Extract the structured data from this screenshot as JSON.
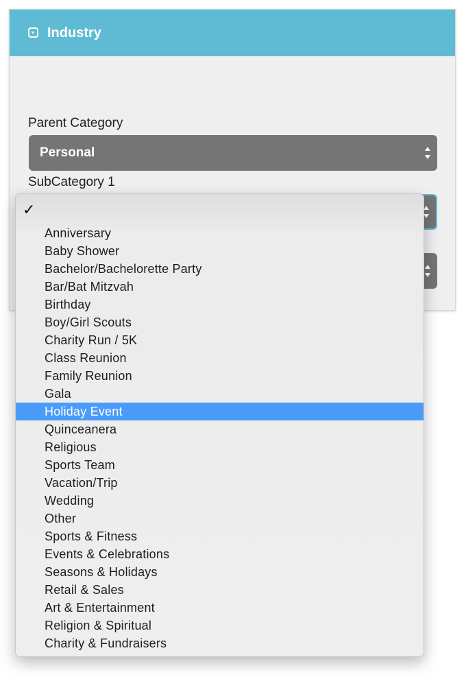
{
  "panel": {
    "title": "Industry",
    "header_icon": "chevron-down-square-icon",
    "header_color": "#5fbbd3"
  },
  "fields": {
    "parent_category": {
      "label": "Parent Category",
      "value": "Personal"
    },
    "subcategory_1": {
      "label": "SubCategory 1",
      "value": ""
    }
  },
  "dropdown": {
    "checkmark": "✓",
    "selected_option": "Holiday Event",
    "highlight_color": "#4b9bf9",
    "options": [
      "Anniversary",
      "Baby Shower",
      "Bachelor/Bachelorette Party",
      "Bar/Bat Mitzvah",
      "Birthday",
      "Boy/Girl Scouts",
      "Charity Run / 5K",
      "Class Reunion",
      "Family Reunion",
      "Gala",
      "Holiday Event",
      "Quinceanera",
      "Religious",
      "Sports Team",
      "Vacation/Trip",
      "Wedding",
      "Other",
      "Sports & Fitness",
      "Events & Celebrations",
      "Seasons & Holidays",
      "Retail & Sales",
      "Art & Entertainment",
      "Religion & Spiritual",
      "Charity & Fundraisers"
    ]
  }
}
